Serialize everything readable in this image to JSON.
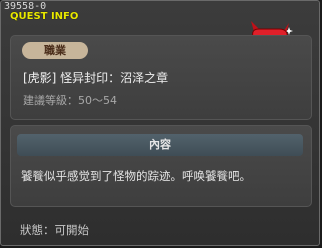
{
  "window": {
    "quest_id": "39558-0",
    "title": "QUEST INFO"
  },
  "quest": {
    "job_badge": "職業",
    "name": "[虎影] 怪异封印：沼泽之章",
    "level_label": "建議等級：50～54"
  },
  "content": {
    "header": "內容",
    "text": "饕餮似乎感觉到了怪物的踪迹。呼唤饕餮吧。"
  },
  "status": {
    "text": "狀態：可開始"
  },
  "icons": {
    "monster": "red-demon-monster-icon"
  },
  "colors": {
    "title": "#e8e800",
    "badge_bg": "#c7b59a",
    "header_bg": "#4a5a64",
    "monster_red": "#e0202a"
  }
}
